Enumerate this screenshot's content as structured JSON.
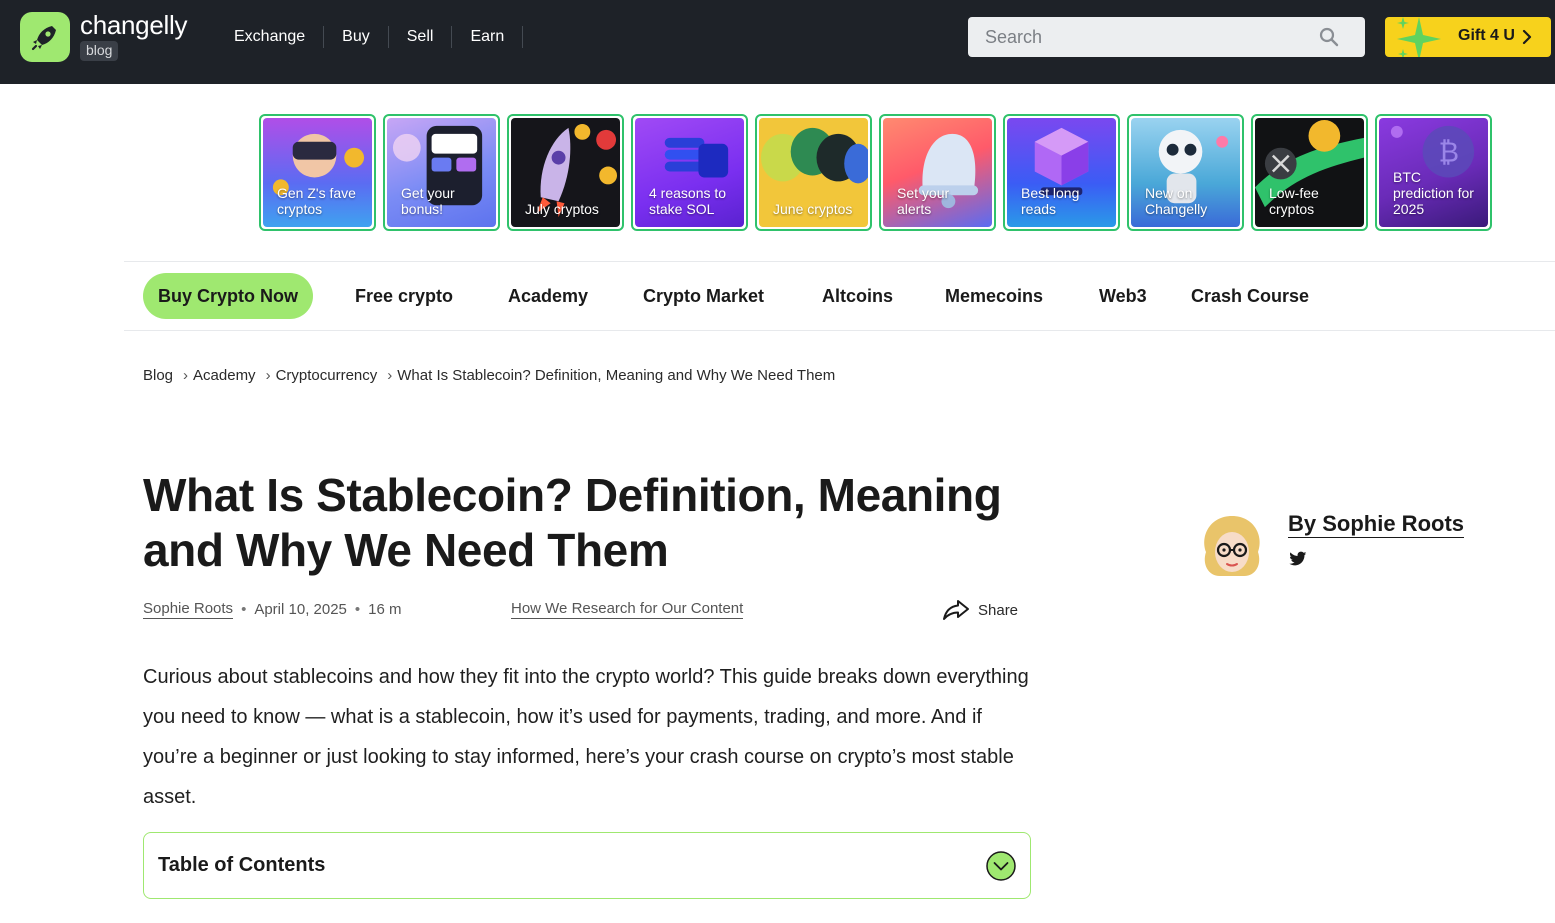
{
  "header": {
    "brand": "changelly",
    "brand_sub": "blog",
    "nav": [
      "Exchange",
      "Buy",
      "Sell",
      "Earn"
    ],
    "search_placeholder": "Search",
    "gift_label": "Gift 4 U"
  },
  "stories": [
    {
      "caption": "Gen Z's fave cryptos",
      "color": "#5b6cf2"
    },
    {
      "caption": "Get your bonus!",
      "color": "#7b8cf5"
    },
    {
      "caption": "July cryptos",
      "color": "#15151a"
    },
    {
      "caption": "4 reasons to stake SOL",
      "color": "#7a2ff0"
    },
    {
      "caption": "June cryptos",
      "color": "#f2c63a"
    },
    {
      "caption": "Set your alerts",
      "color": "#ff6b5a"
    },
    {
      "caption": "Best long reads",
      "color": "#3b5cf5"
    },
    {
      "caption": "New on Changelly",
      "color": "#4aa8d8"
    },
    {
      "caption": "Low-fee cryptos",
      "color": "#111214"
    },
    {
      "caption": "BTC prediction for 2025",
      "color": "#6a2bb8"
    }
  ],
  "categories": {
    "cta": "Buy Crypto Now",
    "links": [
      "Free crypto",
      "Academy",
      "Crypto Market",
      "Altcoins",
      "Memecoins",
      "Web3",
      "Crash Course"
    ]
  },
  "breadcrumb": [
    "Blog",
    "Academy",
    "Cryptocurrency",
    "What Is Stablecoin? Definition, Meaning and Why We Need Them"
  ],
  "article": {
    "title": "What Is Stablecoin? Definition, Meaning and Why We Need Them",
    "author": "Sophie Roots",
    "date": "April 10, 2025",
    "read_time": "16 m",
    "research_link": "How We Research for Our Content",
    "share_label": "Share",
    "intro": "Curious about stablecoins and how they fit into the crypto world? This guide breaks down everything you need to know — what is a stablecoin, how it’s used for payments, trading, and more. And if you’re a beginner or just looking to stay informed, here’s your crash course on crypto’s most stable asset.",
    "toc_title": "Table of Contents"
  },
  "author_card": {
    "name": "By Sophie Roots"
  },
  "colors": {
    "accent": "#9fe870",
    "header_bg": "#1e2228",
    "gift_bg": "#f7d21c",
    "story_border": "#2fc26b"
  }
}
